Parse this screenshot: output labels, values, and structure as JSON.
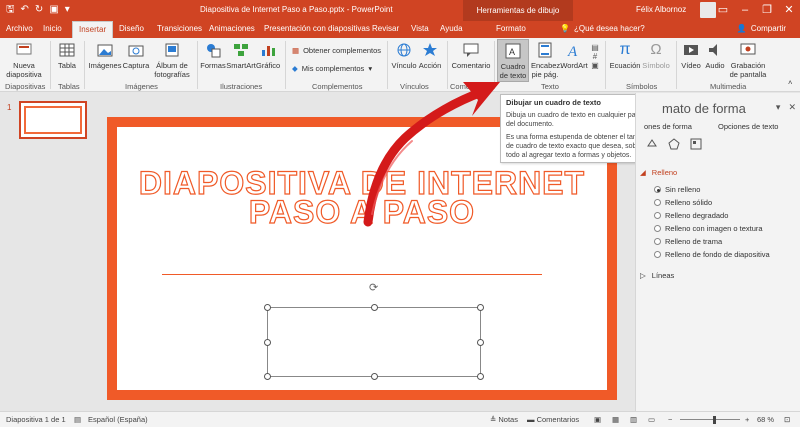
{
  "window": {
    "title": "Diapositiva de Internet Paso a Paso.pptx - PowerPoint",
    "contextual_tab_group": "Herramientas de dibujo",
    "user": "Félix Albornoz",
    "qat_icons": [
      "save-icon",
      "undo-icon",
      "redo-icon",
      "start-slideshow-icon",
      "customize-icon"
    ]
  },
  "tabs": [
    "Archivo",
    "Inicio",
    "Insertar",
    "Diseño",
    "Transiciones",
    "Animaciones",
    "Presentación con diapositivas",
    "Revisar",
    "Vista",
    "Ayuda",
    "Formato"
  ],
  "active_tab": "Insertar",
  "tell_me": "¿Qué desea hacer?",
  "share": "Compartir",
  "ribbon": {
    "diapositivas": {
      "new_slide": "Nueva diapositiva",
      "label": "Diapositivas"
    },
    "tablas": {
      "table": "Tabla",
      "label": "Tablas"
    },
    "imagenes": {
      "images": "Imágenes",
      "capture": "Captura",
      "album": "Álbum de fotografías",
      "label": "Imágenes"
    },
    "ilustraciones": {
      "shapes": "Formas",
      "smartart": "SmartArt",
      "chart": "Gráfico",
      "label": "Ilustraciones"
    },
    "complementos": {
      "get": "Obtener complementos",
      "mine": "Mis complementos",
      "label": "Complementos"
    },
    "vinculos": {
      "link": "Vínculo",
      "action": "Acción",
      "label": "Vínculos"
    },
    "comentarios": {
      "comment": "Comentario",
      "label": "Comentarios"
    },
    "texto": {
      "textbox": "Cuadro de texto",
      "header": "Encabez. pie pág.",
      "wordart": "WordArt",
      "label": "Texto"
    },
    "simbolos": {
      "equation": "Ecuación",
      "symbol": "Símbolo",
      "label": "Símbolos"
    },
    "multimedia": {
      "video": "Vídeo",
      "audio": "Audio",
      "screen_rec": "Grabación de pantalla",
      "label": "Multimedia"
    }
  },
  "tooltip": {
    "title": "Dibujar un cuadro de texto",
    "body1": "Dibuja un cuadro de texto en cualquier parte del documento.",
    "body2": "Es una forma estupenda de obtener el tamaño de cuadro de texto exacto que desea, sobre todo al agregar texto a formas y objetos."
  },
  "slides": {
    "current_number": "1",
    "title": "DIAPOSITIVA DE INTERNET PASO A PASO"
  },
  "format_pane": {
    "title": "mato de forma",
    "tab_shape": "ones de forma",
    "tab_text": "Opciones de texto",
    "fill_section": "Relleno",
    "fill_options": [
      "Sin relleno",
      "Relleno sólido",
      "Relleno degradado",
      "Relleno con imagen o textura",
      "Relleno de trama",
      "Relleno de fondo de diapositiva"
    ],
    "selected_fill": "Sin relleno",
    "line_section": "Líneas"
  },
  "status": {
    "slide_count": "Diapositiva 1 de 1",
    "language": "Español (España)",
    "notes": "Notas",
    "comments": "Comentarios",
    "zoom": "68 %"
  },
  "colors": {
    "accent": "#d04423",
    "slide_orange": "#f05a28",
    "arrow_red": "#d41a1a"
  }
}
